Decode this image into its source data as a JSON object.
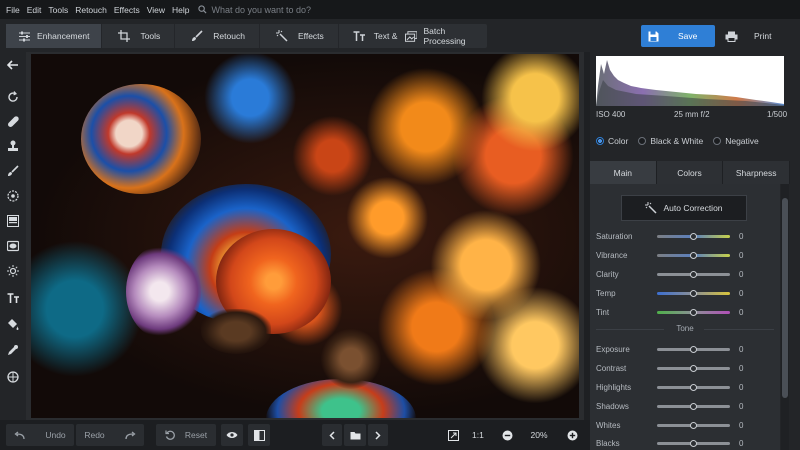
{
  "menu": {
    "items": [
      "File",
      "Edit",
      "Tools",
      "Retouch",
      "Effects",
      "View",
      "Help"
    ],
    "search_placeholder": "What do you want to do?"
  },
  "toolbar": {
    "tabs": [
      {
        "label": "Enhancement",
        "icon": "sliders-icon",
        "active": true
      },
      {
        "label": "Tools",
        "icon": "crop-icon",
        "active": false
      },
      {
        "label": "Retouch",
        "icon": "brush-icon",
        "active": false
      },
      {
        "label": "Effects",
        "icon": "magic-wand-icon",
        "active": false
      },
      {
        "label": "Text & Frames",
        "icon": "text-icon",
        "active": false
      }
    ],
    "batch_label": "Batch Processing",
    "save_label": "Save",
    "print_label": "Print",
    "accent_color": "#2f7fd6"
  },
  "left_tools": [
    "back-arrow-icon",
    "rotate-icon",
    "healing-icon",
    "stamp-icon",
    "brush-icon",
    "radial-icon",
    "gradient-icon",
    "vignette-icon",
    "light-icon",
    "text-icon",
    "fill-icon",
    "color-picker-icon",
    "globe-icon"
  ],
  "bottom": {
    "undo_label": "Undo",
    "redo_label": "Redo",
    "reset_label": "Reset",
    "ratio_label": "1:1",
    "zoom_value": "20%"
  },
  "panel": {
    "exif": {
      "iso": "ISO 400",
      "lens": "25 mm f/2",
      "shutter": "1/500"
    },
    "modes": [
      {
        "label": "Color",
        "selected": true
      },
      {
        "label": "Black & White",
        "selected": false
      },
      {
        "label": "Negative",
        "selected": false
      }
    ],
    "tabs": [
      {
        "label": "Main",
        "active": true
      },
      {
        "label": "Colors",
        "active": false
      },
      {
        "label": "Sharpness",
        "active": false
      }
    ],
    "auto_correction_label": "Auto Correction",
    "main_sliders": [
      {
        "label": "Saturation",
        "value": "0",
        "track": "saturation"
      },
      {
        "label": "Vibrance",
        "value": "0",
        "track": "vibrance"
      },
      {
        "label": "Clarity",
        "value": "0",
        "track": "gray"
      },
      {
        "label": "Temp",
        "value": "0",
        "track": "temp"
      },
      {
        "label": "Tint",
        "value": "0",
        "track": "tint"
      }
    ],
    "tone_label": "Tone",
    "tone_sliders": [
      {
        "label": "Exposure",
        "value": "0"
      },
      {
        "label": "Contrast",
        "value": "0"
      },
      {
        "label": "Highlights",
        "value": "0"
      },
      {
        "label": "Shadows",
        "value": "0"
      },
      {
        "label": "Whites",
        "value": "0"
      },
      {
        "label": "Blacks",
        "value": "0"
      }
    ]
  }
}
